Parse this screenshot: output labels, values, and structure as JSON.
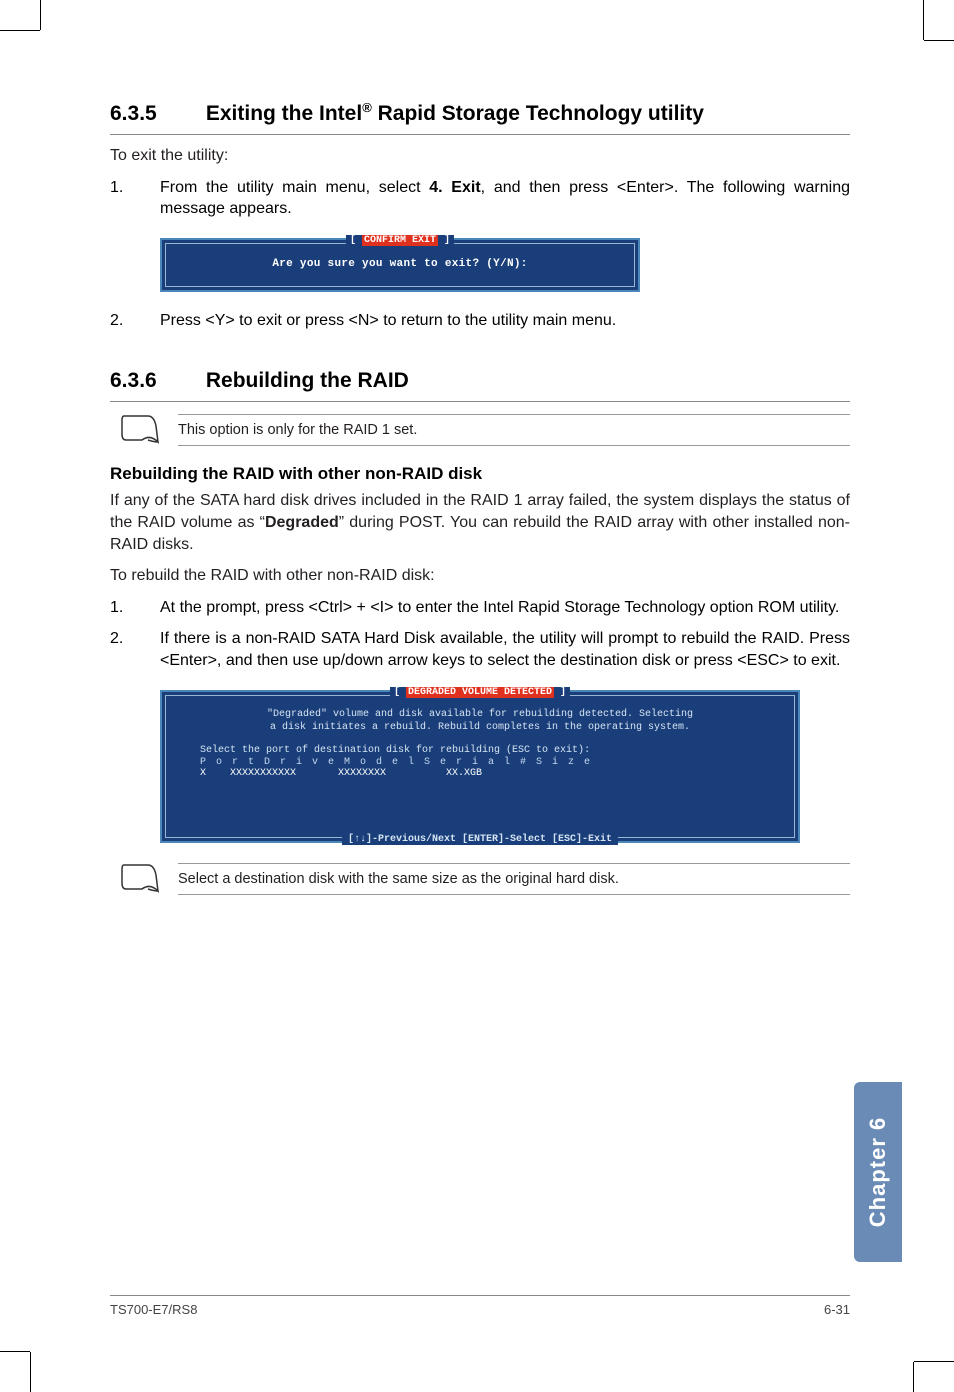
{
  "section635": {
    "num": "6.3.5",
    "title_pre": "Exiting the Intel",
    "title_sup": "®",
    "title_post": " Rapid Storage Technology utility",
    "intro": "To exit the utility:",
    "steps": [
      {
        "n": "1.",
        "t_pre": "From the utility main menu, select ",
        "t_bold": "4. Exit",
        "t_post": ", and then press <Enter>. The following warning message appears."
      },
      {
        "n": "2.",
        "t": "Press <Y> to exit or press <N> to return to the utility main menu."
      }
    ],
    "confirm_title_l": "[ ",
    "confirm_title_red": "CONFIRM EXIT",
    "confirm_title_r": " ]",
    "confirm_text": "Are you sure you want to exit? (Y/N):"
  },
  "section636": {
    "num": "6.3.6",
    "title": "Rebuilding the RAID",
    "note1": "This option is only for the RAID 1 set.",
    "sub_title": "Rebuilding the RAID with other non-RAID disk",
    "para1_pre": "If any of the SATA hard disk drives included in the RAID 1 array failed, the system displays the status of the RAID volume as “",
    "para1_bold": "Degraded",
    "para1_post": "” during POST. You can rebuild the RAID array with other installed non-RAID disks.",
    "para2": "To rebuild the RAID with other non-RAID disk:",
    "steps": [
      {
        "n": "1.",
        "t": "At the prompt, press <Ctrl> + <I> to enter the Intel Rapid Storage Technology option ROM utility."
      },
      {
        "n": "2.",
        "t": "If there is a non-RAID SATA Hard Disk available, the utility will prompt to rebuild the RAID. Press <Enter>, and then use up/down arrow keys to select  the destination disk or press <ESC> to exit."
      }
    ],
    "degraded_title_l": "[ ",
    "degraded_title_red": "DEGRADED VOLUME DETECTED",
    "degraded_title_r": " ]",
    "degraded_para": "\"Degraded\" volume and disk available for rebuilding detected. Selecting\n a disk initiates a rebuild. Rebuild completes in the operating system.",
    "degraded_select": "Select the port of destination disk for rebuilding (ESC to exit):",
    "degraded_hdr": "P o r t   D r i v e   M o d e l               S e r i a l   #                      S i z e",
    "degraded_row": "X    XXXXXXXXXXX       XXXXXXXX          XX.XGB",
    "degraded_foot": "[↑↓]-Previous/Next  [ENTER]-Select  [ESC]-Exit",
    "note2": "Select a destination disk with the same size as the original hard disk."
  },
  "sidetab": "Chapter 6",
  "footer": {
    "left": "TS700-E7/RS8",
    "right": "6-31"
  }
}
